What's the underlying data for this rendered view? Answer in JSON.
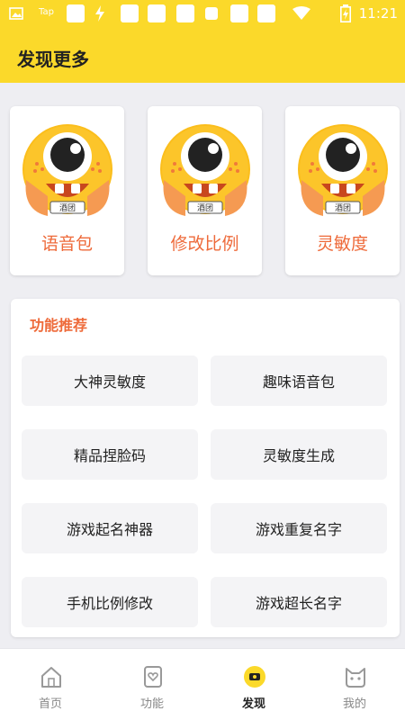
{
  "status_bar": {
    "carrier_text": "Tap",
    "time": "11:21",
    "icons": [
      "image-icon",
      "tap-icon",
      "square-icon",
      "flash-icon",
      "square-icon",
      "square-icon",
      "square-icon",
      "square-icon",
      "square-icon",
      "wifi-icon",
      "battery-charging-icon"
    ]
  },
  "header": {
    "title": "发现更多"
  },
  "top_cards": [
    {
      "label": "语音包",
      "icon": "monster-avatar",
      "badge_text": "酒团"
    },
    {
      "label": "修改比例",
      "icon": "monster-avatar",
      "badge_text": "酒团"
    },
    {
      "label": "灵敏度",
      "icon": "monster-avatar",
      "badge_text": "酒团"
    }
  ],
  "recommend": {
    "title": "功能推荐",
    "items": [
      "大神灵敏度",
      "趣味语音包",
      "精品捏脸码",
      "灵敏度生成",
      "游戏起名神器",
      "游戏重复名字",
      "手机比例修改",
      "游戏超长名字"
    ]
  },
  "tabbar": {
    "tabs": [
      {
        "label": "首页",
        "icon": "home-icon",
        "active": false
      },
      {
        "label": "功能",
        "icon": "feature-heart-icon",
        "active": false
      },
      {
        "label": "发现",
        "icon": "discover-icon",
        "active": true
      },
      {
        "label": "我的",
        "icon": "cat-face-icon",
        "active": false
      }
    ]
  },
  "colors": {
    "brand_yellow": "#fbd92a",
    "accent_orange": "#ee6a3a",
    "page_bg": "#eeeef2"
  }
}
